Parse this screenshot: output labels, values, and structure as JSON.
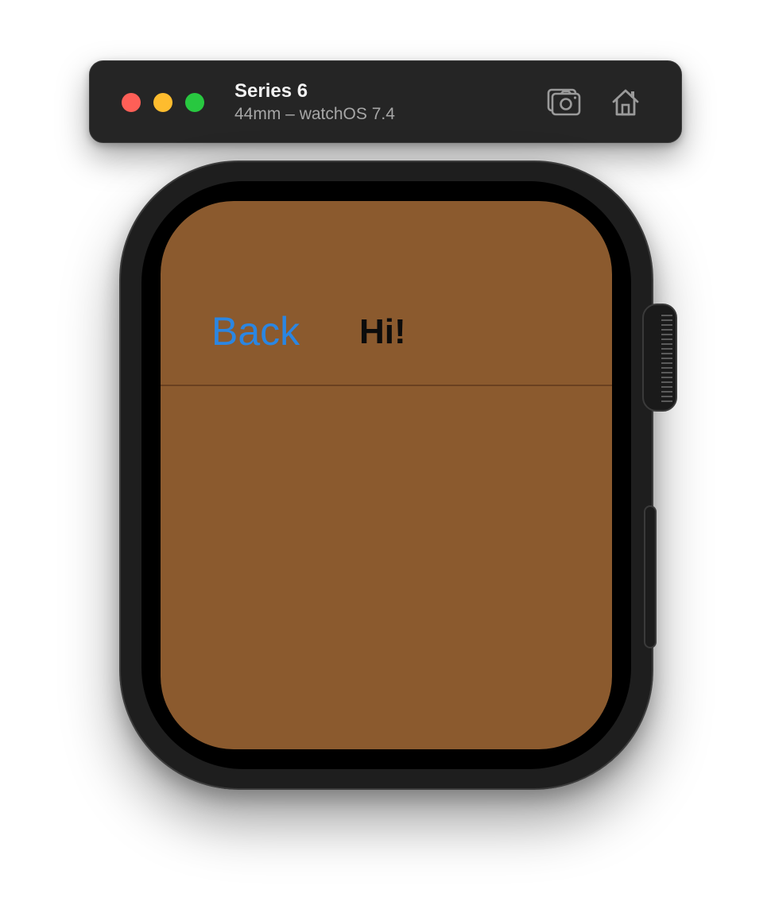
{
  "window": {
    "device_name": "Series 6",
    "device_detail": "44mm – watchOS 7.4",
    "buttons": {
      "close": "close-button",
      "minimize": "minimize-button",
      "zoom": "zoom-button"
    },
    "toolbar_icons": [
      "camera-icon",
      "home-icon"
    ]
  },
  "watch_screen": {
    "background_color": "#8b5a2e",
    "nav": {
      "back_label": "Back",
      "title": "Hi!"
    }
  },
  "colors": {
    "accent": "#2b86e2",
    "titlebar": "#252525",
    "close": "#fe5f57",
    "minimize": "#febc2e",
    "zoom": "#28c840"
  }
}
